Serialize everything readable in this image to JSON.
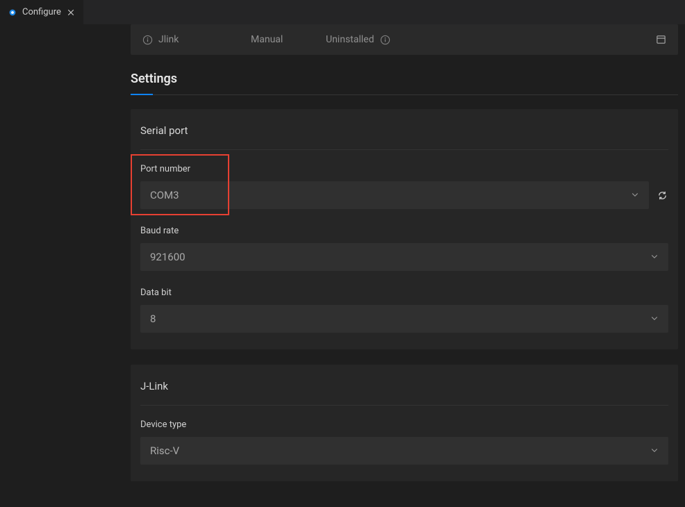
{
  "tab": {
    "label": "Configure"
  },
  "downloader": {
    "name": "Jlink",
    "mode": "Manual",
    "status": "Uninstalled"
  },
  "settings": {
    "title": "Settings"
  },
  "serialPort": {
    "title": "Serial port",
    "portNumber": {
      "label": "Port number",
      "value": "COM3"
    },
    "baudRate": {
      "label": "Baud rate",
      "value": "921600"
    },
    "dataBit": {
      "label": "Data bit",
      "value": "8"
    }
  },
  "jlink": {
    "title": "J-Link",
    "deviceType": {
      "label": "Device type",
      "value": "Risc-V"
    }
  }
}
